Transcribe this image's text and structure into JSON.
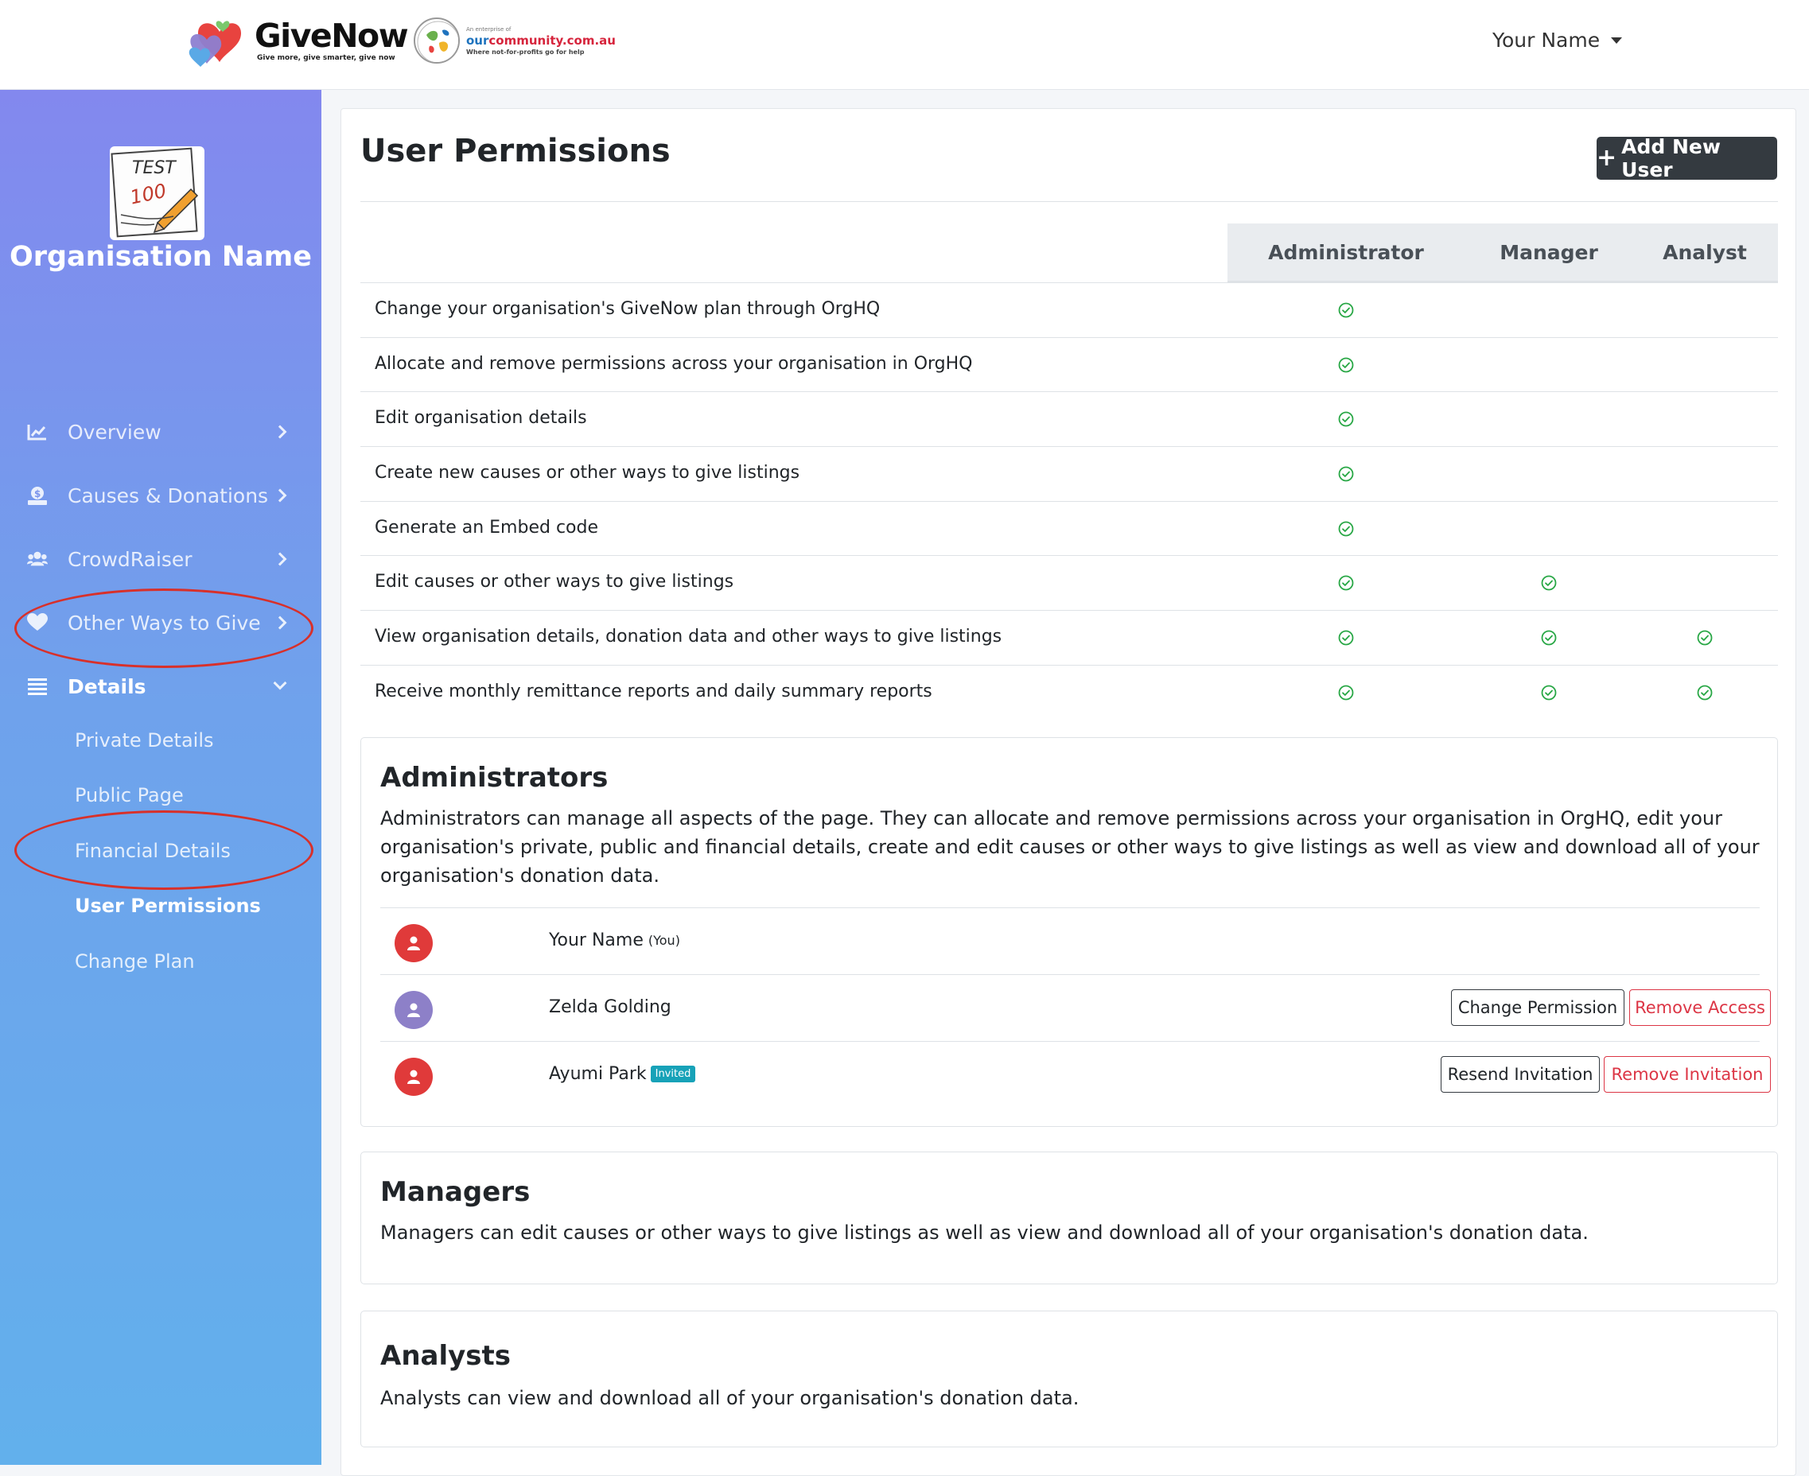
{
  "header": {
    "brand_name": "GiveNow",
    "brand_tagline": "Give more, give smarter, give now",
    "partner_small": "An enterprise of",
    "partner_site_a": "our",
    "partner_site_b": "community.com.au",
    "partner_sub": "Where not-for-profits go for help",
    "user_menu": "Your Name"
  },
  "sidebar": {
    "org_logo_text": "TEST",
    "org_logo_score": "100",
    "org_name": "Organisation Name",
    "items": [
      {
        "label": "Overview",
        "icon": "chart-line-icon"
      },
      {
        "label": "Causes & Donations",
        "icon": "donate-icon"
      },
      {
        "label": "CrowdRaiser",
        "icon": "users-icon"
      },
      {
        "label": "Other Ways to Give",
        "icon": "heart-icon"
      },
      {
        "label": "Details",
        "icon": "list-icon"
      }
    ],
    "sub_items": [
      "Private Details",
      "Public Page",
      "Financial Details",
      "User Permissions",
      "Change Plan"
    ]
  },
  "main": {
    "title": "User Permissions",
    "add_button": "Add New User",
    "table": {
      "columns": [
        "Administrator",
        "Manager",
        "Analyst"
      ],
      "rows": [
        {
          "label": "Change your organisation's GiveNow plan through OrgHQ",
          "admin": true,
          "manager": false,
          "analyst": false
        },
        {
          "label": "Allocate and remove permissions across your organisation in OrgHQ",
          "admin": true,
          "manager": false,
          "analyst": false
        },
        {
          "label": "Edit organisation details",
          "admin": true,
          "manager": false,
          "analyst": false
        },
        {
          "label": "Create new causes or other ways to give listings",
          "admin": true,
          "manager": false,
          "analyst": false
        },
        {
          "label": "Generate an Embed code",
          "admin": true,
          "manager": false,
          "analyst": false
        },
        {
          "label": "Edit causes or other ways to give listings",
          "admin": true,
          "manager": true,
          "analyst": false
        },
        {
          "label": "View organisation details, donation data and other ways to give listings",
          "admin": true,
          "manager": true,
          "analyst": true
        },
        {
          "label": "Receive monthly remittance reports and daily summary reports",
          "admin": true,
          "manager": true,
          "analyst": true
        }
      ]
    },
    "administrators": {
      "title": "Administrators",
      "description": "Administrators can manage all aspects of the page. They can allocate and remove permissions across your organisation in OrgHQ, edit your organisation's private, public and financial details, create and edit causes or other ways to give listings as well as view and download all of your organisation's donation data.",
      "users": [
        {
          "name": "Your Name",
          "you_tag": "(You)"
        },
        {
          "name": "Zelda Golding",
          "button_1": "Change Permission",
          "button_2": "Remove Access"
        },
        {
          "name": "Ayumi Park",
          "badge": "Invited",
          "button_1": "Resend Invitation",
          "button_2": "Remove Invitation"
        }
      ]
    },
    "managers": {
      "title": "Managers",
      "description": "Managers can edit causes or other ways to give listings as well as view and download all of your organisation's donation data."
    },
    "analysts": {
      "title": "Analysts",
      "description": "Analysts can view and download all of your organisation's donation data."
    }
  },
  "colors": {
    "accent_dark": "#343a40",
    "danger": "#dc3545",
    "check": "#28a745",
    "highlight_ring": "#d8302a",
    "sidebar_top": "#8388ee",
    "sidebar_bottom": "#62b0ec"
  }
}
